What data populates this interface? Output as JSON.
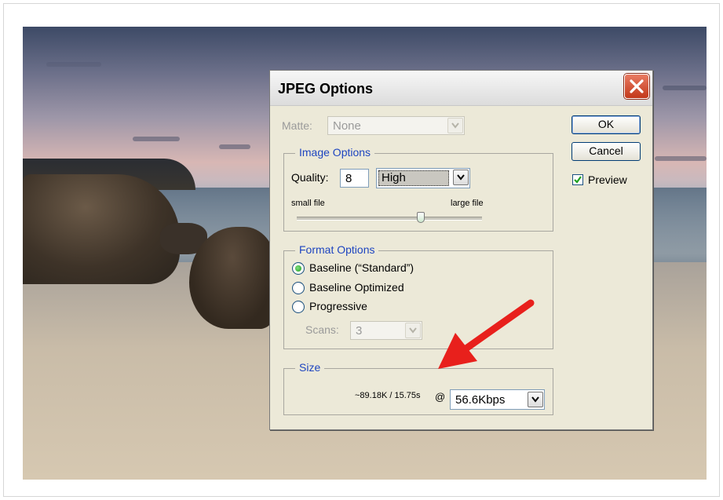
{
  "dialog": {
    "title": "JPEG Options",
    "matte": {
      "label": "Matte:",
      "value": "None"
    },
    "buttons": {
      "ok": "OK",
      "cancel": "Cancel"
    },
    "preview": {
      "label": "Preview",
      "checked": true
    },
    "image_options": {
      "title": "Image Options",
      "quality_label": "Quality:",
      "quality_value": "8",
      "quality_preset": "High",
      "small_file": "small file",
      "large_file": "large file",
      "slider_level": 0.67
    },
    "format_options": {
      "title": "Format Options",
      "choices": [
        "Baseline (“Standard”)",
        "Baseline Optimized",
        "Progressive"
      ],
      "selected_index": 0,
      "scans_label": "Scans:",
      "scans_value": "3"
    },
    "size": {
      "title": "Size",
      "estimate": "~89.18K / 15.75s",
      "at": "@",
      "speed": "56.6Kbps"
    }
  },
  "colors": {
    "arrow": "#e8201c",
    "group_title": "#1e45c0",
    "close_button": "#c2381a"
  },
  "icons": [
    "close-icon",
    "dropdown-arrow-icon",
    "checkmark-icon",
    "slider-thumb-icon",
    "red-arrow-annotation"
  ]
}
